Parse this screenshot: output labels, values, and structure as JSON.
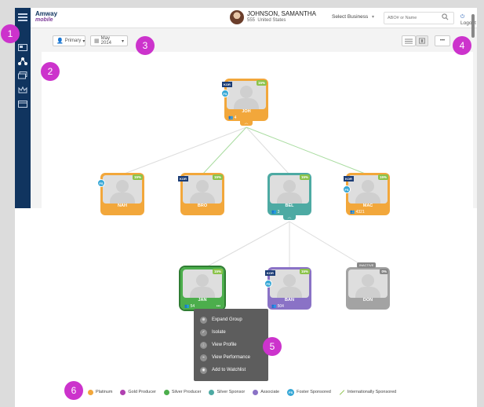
{
  "header": {
    "logo_main": "Amway",
    "logo_sub": "mobile",
    "user_name": "JOHNSON, SAMANTHA",
    "user_id": "555",
    "user_country": "United States",
    "business_select": "Select Business",
    "search_placeholder": "ABO# or Name",
    "logout": "Logout"
  },
  "toolbar": {
    "lineage": "Primary",
    "period": "May 2014",
    "more": "•••"
  },
  "callouts": [
    "1",
    "2",
    "3",
    "4",
    "5",
    "6"
  ],
  "nodes": {
    "joh": {
      "name": "JOH",
      "pct": "15%",
      "kor": "KOR",
      "fs": "FS",
      "count": "4",
      "color": "#f2a73b"
    },
    "nah": {
      "name": "NAH",
      "pct": "15%",
      "fs": "FS",
      "color": "#f2a73b"
    },
    "bro": {
      "name": "BRO",
      "pct": "15%",
      "kor": "KOR",
      "color": "#f2a73b"
    },
    "bel": {
      "name": "BEL",
      "pct": "15%",
      "count": "3",
      "color": "#4daaa3"
    },
    "mac": {
      "name": "MAC",
      "pct": "15%",
      "kor": "KOR",
      "fs": "FS",
      "count": "4321",
      "color": "#f2a73b"
    },
    "jan": {
      "name": "JAN",
      "pct": "15%",
      "count": "54",
      "dots": "•••",
      "color": "#4cae4c"
    },
    "ban": {
      "name": "BAN",
      "pct": "15%",
      "kor": "KOR",
      "fs": "FS",
      "count": "504",
      "color": "#8a72c6"
    },
    "don": {
      "name": "DON",
      "pct": "0%",
      "inactive": "INACTIVE",
      "color": "#a3a3a3"
    }
  },
  "context_menu": {
    "items": [
      "Expand Group",
      "Isolate",
      "View Profile",
      "View Performance",
      "Add to Watchlist"
    ]
  },
  "legend": {
    "items": [
      {
        "label": "Platinum",
        "color": "#f2a73b"
      },
      {
        "label": "Gold Producer",
        "color": "#b040b0"
      },
      {
        "label": "Silver Producer",
        "color": "#4cae4c"
      },
      {
        "label": "Silver Sponsor",
        "color": "#4daaa3"
      },
      {
        "label": "Associate",
        "color": "#8a72c6"
      }
    ],
    "foster_badge": "FS",
    "foster_label": "Foster Sponsored",
    "intl_label": "Internationally Sponsored"
  },
  "colors": {
    "sidebar": "#10345f",
    "callout": "#cc33cc",
    "fs_badge": "#35a7d6"
  }
}
